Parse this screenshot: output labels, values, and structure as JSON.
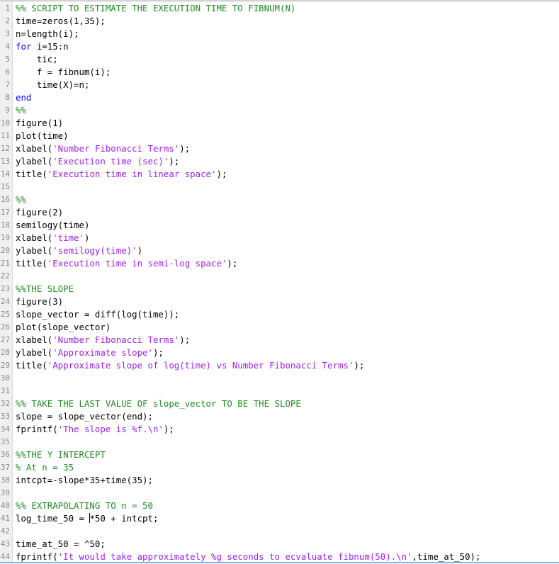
{
  "editor": {
    "language": "MATLAB",
    "cursor_line": 41,
    "lines": [
      {
        "n": "1",
        "segs": [
          {
            "t": "cm",
            "v": "%% SCRIPT TO ESTIMATE THE EXECUTION TIME TO FIBNUM(N)"
          }
        ]
      },
      {
        "n": "2",
        "segs": [
          {
            "t": "tx",
            "v": "time=zeros(1,35);"
          }
        ]
      },
      {
        "n": "3",
        "segs": [
          {
            "t": "tx",
            "v": "n=length(i);"
          }
        ]
      },
      {
        "n": "4",
        "segs": [
          {
            "t": "kw",
            "v": "for"
          },
          {
            "t": "tx",
            "v": " i=15:n"
          }
        ]
      },
      {
        "n": "5",
        "segs": [
          {
            "t": "tx",
            "v": "    tic;"
          }
        ]
      },
      {
        "n": "6",
        "segs": [
          {
            "t": "tx",
            "v": "    f = fibnum(i);"
          }
        ]
      },
      {
        "n": "7",
        "segs": [
          {
            "t": "tx",
            "v": "    time(X)=n;"
          }
        ]
      },
      {
        "n": "8",
        "segs": [
          {
            "t": "kw",
            "v": "end"
          }
        ]
      },
      {
        "n": "9",
        "segs": [
          {
            "t": "cm",
            "v": "%%"
          }
        ]
      },
      {
        "n": "10",
        "segs": [
          {
            "t": "tx",
            "v": "figure(1)"
          }
        ]
      },
      {
        "n": "11",
        "segs": [
          {
            "t": "tx",
            "v": "plot(time)"
          }
        ]
      },
      {
        "n": "12",
        "segs": [
          {
            "t": "tx",
            "v": "xlabel("
          },
          {
            "t": "str",
            "v": "'Number Fibonacci Terms'"
          },
          {
            "t": "tx",
            "v": ");"
          }
        ]
      },
      {
        "n": "13",
        "segs": [
          {
            "t": "tx",
            "v": "ylabel("
          },
          {
            "t": "str",
            "v": "'Execution time (sec)'"
          },
          {
            "t": "tx",
            "v": ");"
          }
        ]
      },
      {
        "n": "14",
        "segs": [
          {
            "t": "tx",
            "v": "title("
          },
          {
            "t": "str",
            "v": "'Execution time in linear space'"
          },
          {
            "t": "tx",
            "v": ");"
          }
        ]
      },
      {
        "n": "15",
        "segs": []
      },
      {
        "n": "16",
        "segs": [
          {
            "t": "cm",
            "v": "%%"
          }
        ]
      },
      {
        "n": "17",
        "segs": [
          {
            "t": "tx",
            "v": "figure(2)"
          }
        ]
      },
      {
        "n": "18",
        "segs": [
          {
            "t": "tx",
            "v": "semilogy(time)"
          }
        ]
      },
      {
        "n": "19",
        "segs": [
          {
            "t": "tx",
            "v": "xlabel("
          },
          {
            "t": "str",
            "v": "'time'"
          },
          {
            "t": "tx",
            "v": ")"
          }
        ]
      },
      {
        "n": "20",
        "segs": [
          {
            "t": "tx",
            "v": "ylabel("
          },
          {
            "t": "str",
            "v": "'semilogy(time)'"
          },
          {
            "t": "tx",
            "v": ")"
          }
        ]
      },
      {
        "n": "21",
        "segs": [
          {
            "t": "tx",
            "v": "title("
          },
          {
            "t": "str",
            "v": "'Execution time in semi-log space'"
          },
          {
            "t": "tx",
            "v": ");"
          }
        ]
      },
      {
        "n": "22",
        "segs": []
      },
      {
        "n": "23",
        "segs": [
          {
            "t": "cm",
            "v": "%%THE SLOPE"
          }
        ]
      },
      {
        "n": "24",
        "segs": [
          {
            "t": "tx",
            "v": "figure(3)"
          }
        ]
      },
      {
        "n": "25",
        "segs": [
          {
            "t": "tx",
            "v": "slope_vector = diff(log(time));"
          }
        ]
      },
      {
        "n": "26",
        "segs": [
          {
            "t": "tx",
            "v": "plot(slope_vector)"
          }
        ]
      },
      {
        "n": "27",
        "segs": [
          {
            "t": "tx",
            "v": "xlabel("
          },
          {
            "t": "str",
            "v": "'Number Fibonacci Terms'"
          },
          {
            "t": "tx",
            "v": ");"
          }
        ]
      },
      {
        "n": "28",
        "segs": [
          {
            "t": "tx",
            "v": "ylabel("
          },
          {
            "t": "str",
            "v": "'Approximate slope'"
          },
          {
            "t": "tx",
            "v": ");"
          }
        ]
      },
      {
        "n": "29",
        "segs": [
          {
            "t": "tx",
            "v": "title("
          },
          {
            "t": "str",
            "v": "'Approximate slope of log(time) vs Number Fibonacci Terms'"
          },
          {
            "t": "tx",
            "v": ");"
          }
        ]
      },
      {
        "n": "30",
        "segs": []
      },
      {
        "n": "31",
        "segs": []
      },
      {
        "n": "32",
        "segs": [
          {
            "t": "cm",
            "v": "%% TAKE THE LAST VALUE OF slope_vector TO BE THE SLOPE"
          }
        ]
      },
      {
        "n": "33",
        "segs": [
          {
            "t": "tx",
            "v": "slope = slope_vector(end);"
          }
        ]
      },
      {
        "n": "34",
        "segs": [
          {
            "t": "tx",
            "v": "fprintf("
          },
          {
            "t": "str",
            "v": "'The slope is %f.\\n'"
          },
          {
            "t": "tx",
            "v": ");"
          }
        ]
      },
      {
        "n": "35",
        "segs": []
      },
      {
        "n": "36",
        "segs": [
          {
            "t": "cm",
            "v": "%%THE Y INTERCEPT"
          }
        ]
      },
      {
        "n": "37",
        "segs": [
          {
            "t": "cm",
            "v": "% At n = 35"
          }
        ]
      },
      {
        "n": "38",
        "segs": [
          {
            "t": "tx",
            "v": "intcpt=-slope*35+time(35);"
          }
        ]
      },
      {
        "n": "39",
        "segs": []
      },
      {
        "n": "40",
        "segs": [
          {
            "t": "cm",
            "v": "%% EXTRAPOLATING TO n = 50"
          }
        ]
      },
      {
        "n": "41",
        "segs": [
          {
            "t": "tx",
            "v": "log_time_50 = "
          },
          {
            "t": "caret",
            "v": ""
          },
          {
            "t": "tx",
            "v": "*50 + intcpt;"
          }
        ]
      },
      {
        "n": "42",
        "segs": []
      },
      {
        "n": "43",
        "segs": [
          {
            "t": "tx",
            "v": "time_at_50 = ^50;"
          }
        ]
      },
      {
        "n": "44",
        "segs": [
          {
            "t": "tx",
            "v": "fprintf("
          },
          {
            "t": "str",
            "v": "'It would take approximately %g seconds to ecvaluate fibnum(50).\\n'"
          },
          {
            "t": "tx",
            "v": ",time_at_50);"
          }
        ]
      }
    ]
  }
}
